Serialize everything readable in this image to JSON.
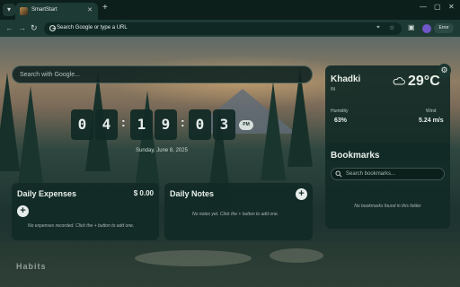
{
  "browser": {
    "tab_title": "SmartStart",
    "address": "Search Google or type a URL",
    "profile_label": "Error"
  },
  "page": {
    "search": {
      "placeholder": "Search with Google..."
    },
    "clock": {
      "h1": "0",
      "h2": "4",
      "m1": "1",
      "m2": "9",
      "s1": "0",
      "s2": "3",
      "period": "PM",
      "date": "Sunday, June 8, 2025"
    },
    "weather": {
      "city": "Khadki",
      "country": "IN",
      "temperature": "29°C",
      "humidity_label": "Humidity",
      "humidity": "63%",
      "wind_label": "Wind",
      "wind": "5.24 m/s",
      "condition_icon": "partly-cloudy-icon"
    },
    "bookmarks": {
      "title": "Bookmarks",
      "search_placeholder": "Search bookmarks...",
      "empty": "No bookmarks found in this folder"
    },
    "expenses": {
      "title": "Daily Expenses",
      "total": "$ 0.00",
      "empty": "No expenses recorded. Click the + button to add one."
    },
    "notes": {
      "title": "Daily Notes",
      "empty": "No notes yet. Click the + button to add one."
    },
    "bottom_title": "Habits"
  },
  "colors": {
    "card_bg": "#122a26",
    "accent_light": "#e6ecea",
    "chrome_bg": "#0c1f1b"
  }
}
